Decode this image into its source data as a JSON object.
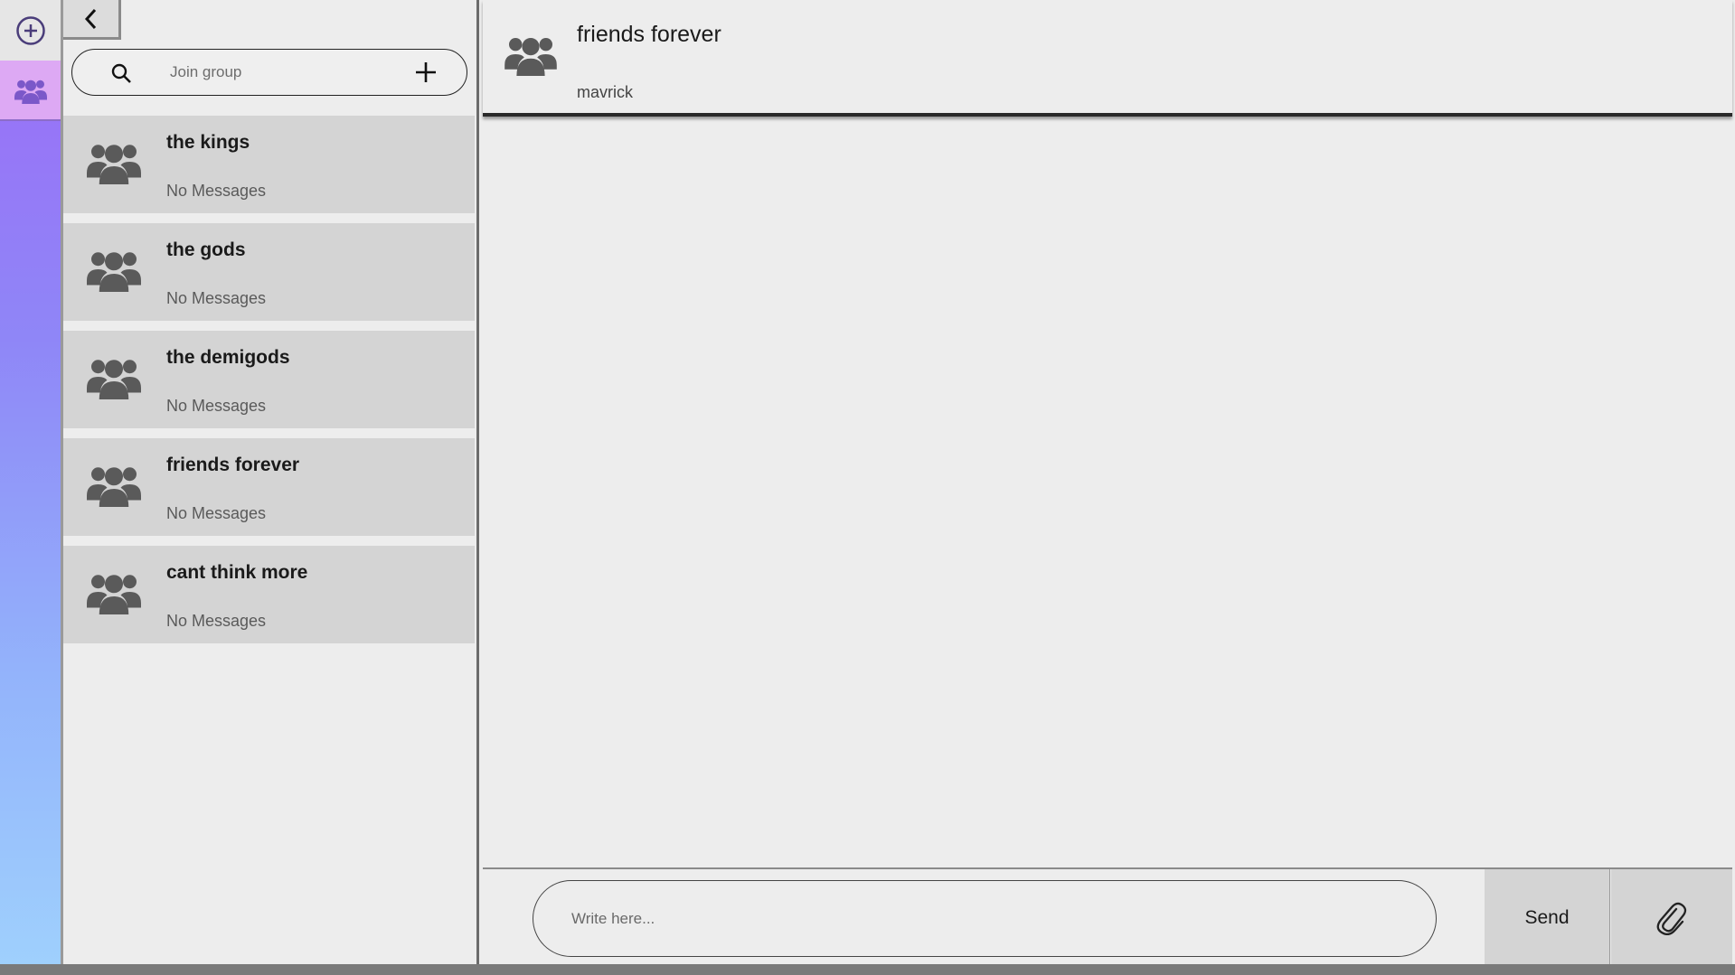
{
  "rail": {
    "add_icon": "plus-circle-icon",
    "groups_icon": "users-icon"
  },
  "list": {
    "back_icon": "chevron-left-icon",
    "search": {
      "placeholder": "Join group",
      "icon": "search-icon",
      "add_icon": "plus-icon"
    },
    "groups": [
      {
        "name": "the kings",
        "last": "No Messages"
      },
      {
        "name": "the gods",
        "last": "No Messages"
      },
      {
        "name": "the demigods",
        "last": "No Messages"
      },
      {
        "name": "friends forever",
        "last": "No Messages"
      },
      {
        "name": "cant think more",
        "last": "No Messages"
      }
    ]
  },
  "chat": {
    "title": "friends forever",
    "subtitle": "mavrick",
    "composer": {
      "placeholder": "Write here...",
      "send_label": "Send",
      "attach_icon": "paperclip-icon"
    }
  },
  "colors": {
    "rail_gradient_top": "#9b6cf7",
    "rail_gradient_bottom": "#9fd0fd",
    "rail_active": "#dda9f4",
    "item_bg": "#d4d4d4",
    "panel_bg": "#ededed",
    "icon": "#5a5a5a"
  }
}
